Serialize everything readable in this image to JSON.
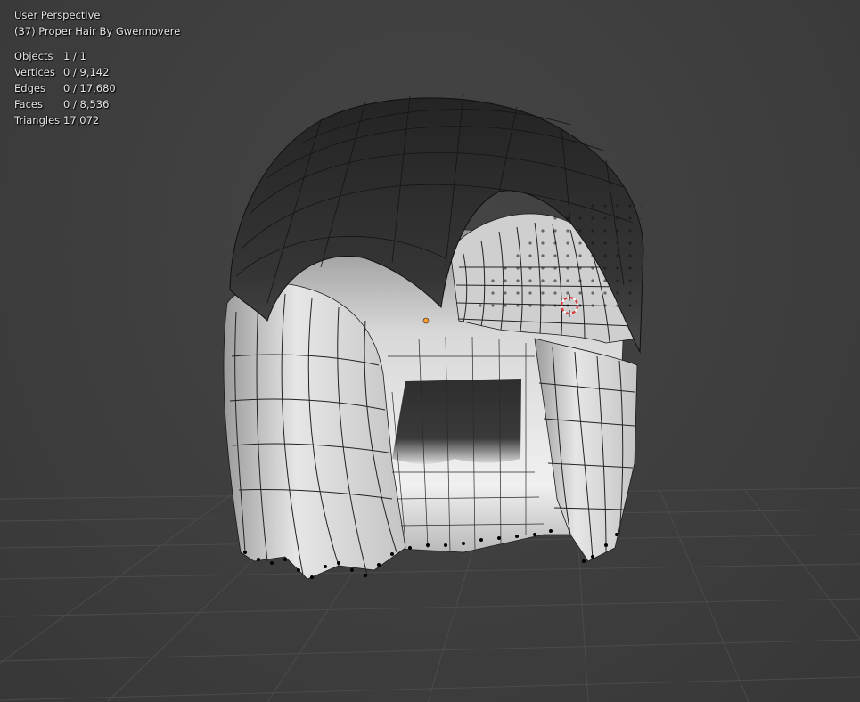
{
  "viewport": {
    "view_name": "User Perspective",
    "object_info": "(37) Proper Hair By Gwennovere"
  },
  "stats": [
    {
      "label": "Objects",
      "value": "1 / 1"
    },
    {
      "label": "Vertices",
      "value": "0 / 9,142"
    },
    {
      "label": "Edges",
      "value": "0 / 17,680"
    },
    {
      "label": "Faces",
      "value": "0 / 8,536"
    },
    {
      "label": "Triangles",
      "value": "17,072"
    }
  ],
  "colors": {
    "background": "#3d3d3d",
    "grid": "#4a4a4a",
    "mesh_light": "#d9d9d9",
    "mesh_dark": "#2a2a2a",
    "vertex": "#000000",
    "origin": "#ff9a2e",
    "cursor": "#d43a3a"
  },
  "icons": {
    "origin": "origin-dot-icon",
    "cursor": "3d-cursor-icon"
  }
}
